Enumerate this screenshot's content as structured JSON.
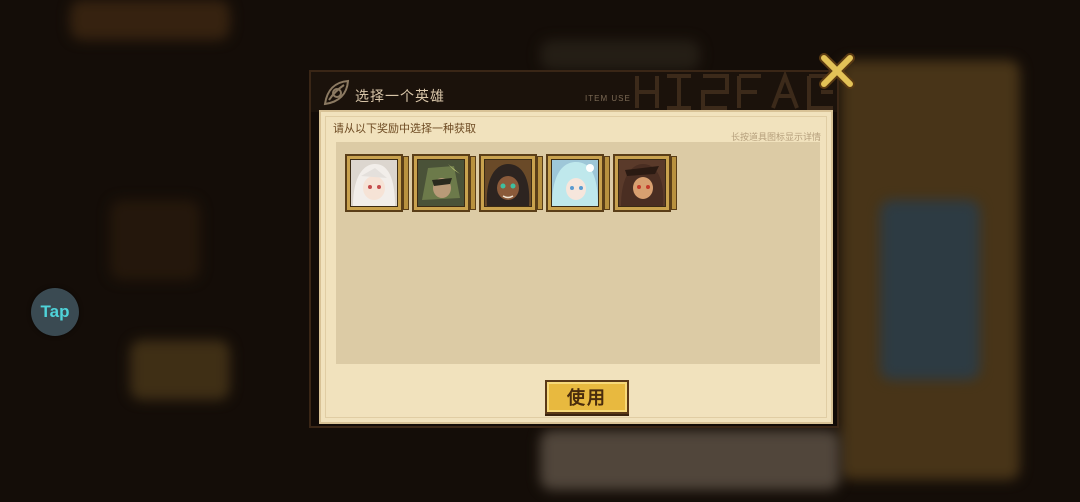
{
  "dialog": {
    "title": "选择一个英雄",
    "header_tag": "ITEM USE",
    "subtitle": "请从以下奖励中选择一种获取",
    "hint": "长按道具图标显示详情",
    "use_label": "使用"
  },
  "overlay": {
    "tap_label": "Tap"
  },
  "heroes": [
    {
      "icon": "hero-portrait-white-hair-icon",
      "colors": [
        "#e9e3de",
        "#c44c4c"
      ]
    },
    {
      "icon": "hero-portrait-green-helmet-icon",
      "colors": [
        "#6c7a4a",
        "#c8d07a"
      ]
    },
    {
      "icon": "hero-portrait-dark-hair-icon",
      "colors": [
        "#2d2420",
        "#3fbfa0"
      ]
    },
    {
      "icon": "hero-portrait-cyan-hair-icon",
      "colors": [
        "#bfe8ec",
        "#5a9bd0"
      ]
    },
    {
      "icon": "hero-portrait-brown-hair-icon",
      "colors": [
        "#4a2e22",
        "#d8a070"
      ]
    }
  ],
  "colors": {
    "accent_gold": "#e8b93f",
    "close_icon": "#e3c257"
  }
}
